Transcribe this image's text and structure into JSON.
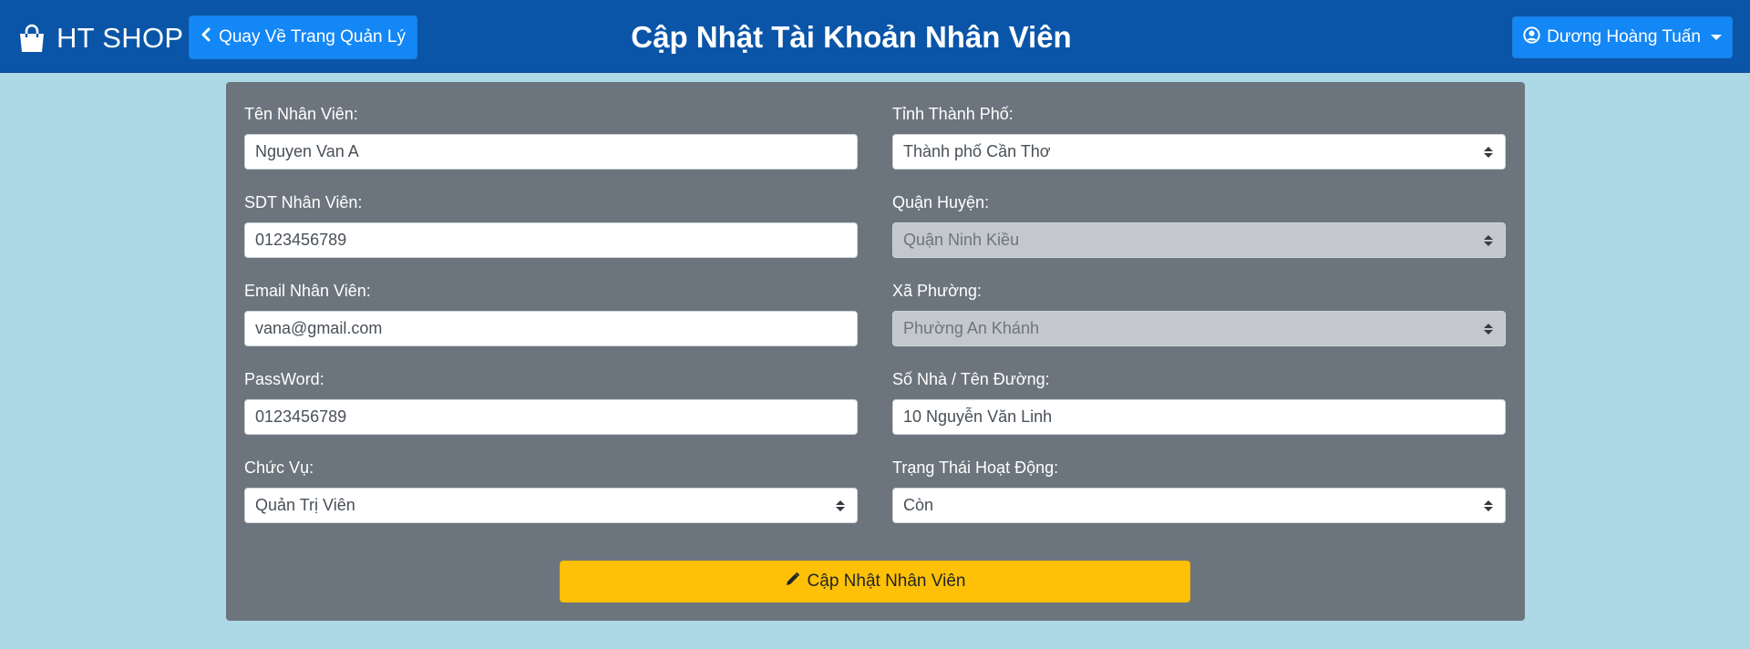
{
  "header": {
    "brand": "HT SHOP",
    "back_button_label": "Quay Về Trang Quản Lý",
    "title": "Cập Nhật Tài Khoản Nhân Viên",
    "user_name": "Dương Hoàng Tuấn"
  },
  "form": {
    "name": {
      "label": "Tên Nhân Viên:",
      "value": "Nguyen Van A"
    },
    "phone": {
      "label": "SDT Nhân Viên:",
      "value": "0123456789"
    },
    "email": {
      "label": "Email Nhân Viên:",
      "value": "vana@gmail.com"
    },
    "password": {
      "label": "PassWord:",
      "value": "0123456789"
    },
    "role": {
      "label": "Chức Vụ:",
      "value": "Quản Trị Viên"
    },
    "province": {
      "label": "Tỉnh Thành Phố:",
      "value": "Thành phố Cần Thơ"
    },
    "district": {
      "label": "Quận Huyện:",
      "value": "Quận Ninh Kiều"
    },
    "ward": {
      "label": "Xã Phường:",
      "value": "Phường An Khánh"
    },
    "address": {
      "label": "Số Nhà / Tên Đường:",
      "value": "10 Nguyễn Văn Linh"
    },
    "status": {
      "label": "Trạng Thái Hoạt Động:",
      "value": "Còn"
    },
    "submit_label": "Cập Nhật Nhân Viên"
  },
  "colors": {
    "page_background": "#add8e6",
    "navbar": "#0a55a8",
    "primary_button": "#1387f5",
    "card": "#6c757d",
    "submit_button": "#ffc107"
  },
  "icons": {
    "brand": "shopping-bag-icon",
    "back": "chevron-left-icon",
    "user": "user-circle-icon",
    "dropdown": "caret-down-icon",
    "select": "select-arrows-icon",
    "submit": "pencil-icon"
  }
}
